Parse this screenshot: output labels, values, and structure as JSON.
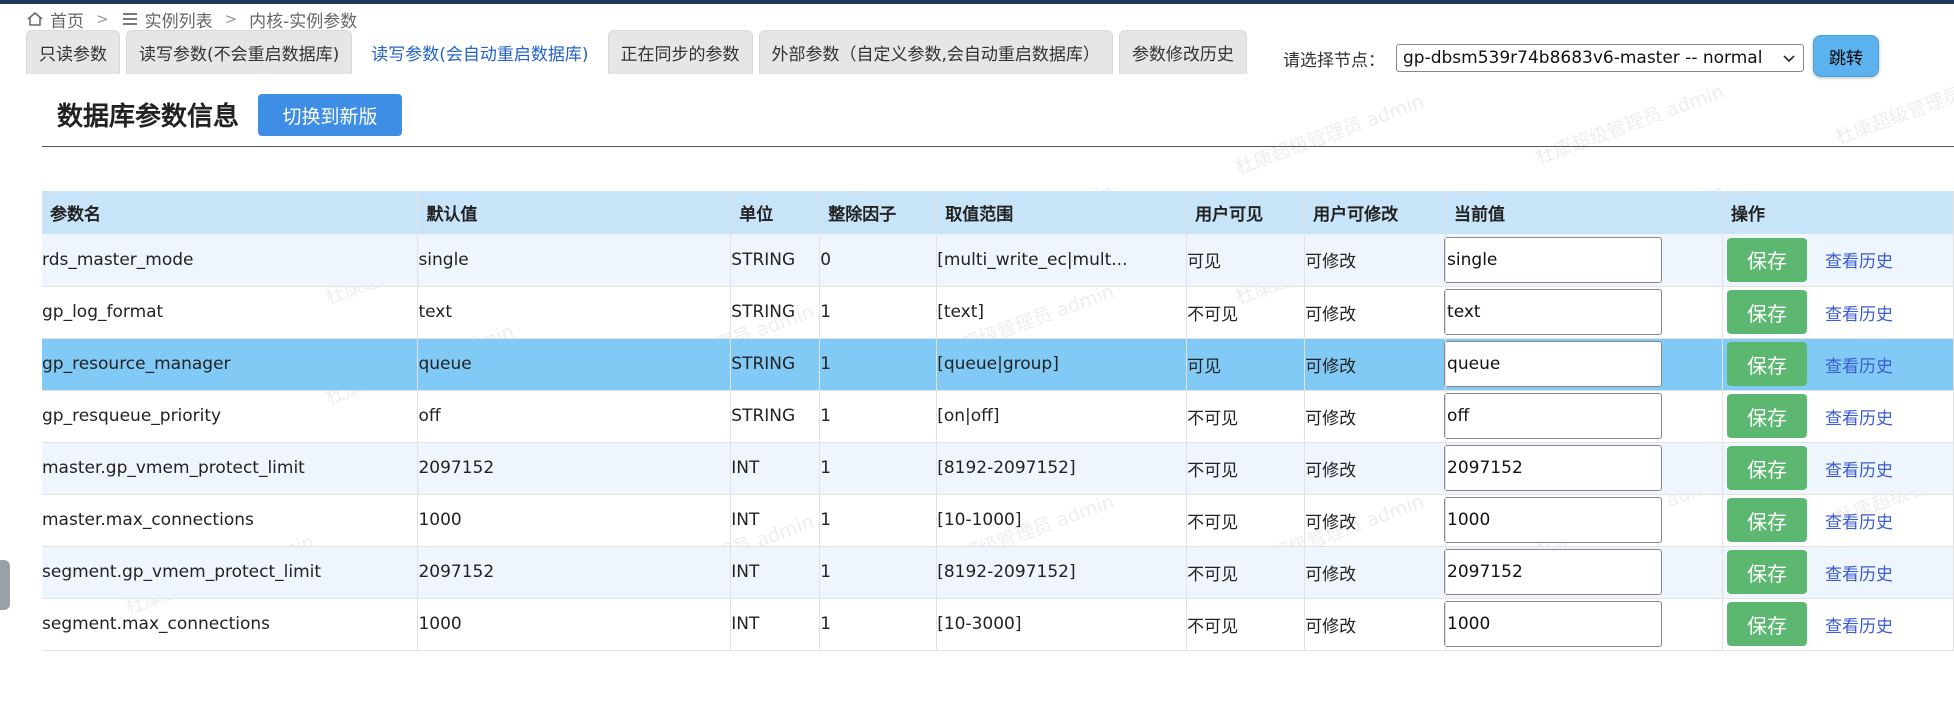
{
  "breadcrumb": {
    "home": "首页",
    "list": "实例列表",
    "current": "内核-实例参数"
  },
  "tabs": [
    {
      "label": "只读参数"
    },
    {
      "label": "读写参数(不会重启数据库)"
    },
    {
      "label": "读写参数(会自动重启数据库)"
    },
    {
      "label": "正在同步的参数"
    },
    {
      "label": "外部参数（自定义参数,会自动重启数据库）"
    },
    {
      "label": "参数修改历史"
    }
  ],
  "node": {
    "label": "请选择节点：",
    "selected": "gp-dbsm539r74b8683v6-master -- normal",
    "jump_label": "跳转"
  },
  "page": {
    "title": "数据库参数信息",
    "switch_label": "切换到新版"
  },
  "watermark": "杜康超级管理员 admin",
  "table": {
    "headers": [
      "参数名",
      "默认值",
      "单位",
      "整除因子",
      "取值范围",
      "用户可见",
      "用户可修改",
      "当前值",
      "操作"
    ],
    "save_label": "保存",
    "history_label": "查看历史",
    "rows": [
      {
        "name": "rds_master_mode",
        "default": "single",
        "unit": "STRING",
        "factor": "0",
        "range": "[multi_write_ec|mult...",
        "visible": "可见",
        "modifiable": "可修改",
        "current": "single"
      },
      {
        "name": "gp_log_format",
        "default": "text",
        "unit": "STRING",
        "factor": "1",
        "range": "[text]",
        "visible": "不可见",
        "modifiable": "可修改",
        "current": "text"
      },
      {
        "name": "gp_resource_manager",
        "default": "queue",
        "unit": "STRING",
        "factor": "1",
        "range": "[queue|group]",
        "visible": "可见",
        "modifiable": "可修改",
        "current": "queue"
      },
      {
        "name": "gp_resqueue_priority",
        "default": "off",
        "unit": "STRING",
        "factor": "1",
        "range": "[on|off]",
        "visible": "不可见",
        "modifiable": "可修改",
        "current": "off"
      },
      {
        "name": "master.gp_vmem_protect_limit",
        "default": "2097152",
        "unit": "INT",
        "factor": "1",
        "range": "[8192-2097152]",
        "visible": "不可见",
        "modifiable": "可修改",
        "current": "2097152"
      },
      {
        "name": "master.max_connections",
        "default": "1000",
        "unit": "INT",
        "factor": "1",
        "range": "[10-1000]",
        "visible": "不可见",
        "modifiable": "可修改",
        "current": "1000"
      },
      {
        "name": "segment.gp_vmem_protect_limit",
        "default": "2097152",
        "unit": "INT",
        "factor": "1",
        "range": "[8192-2097152]",
        "visible": "不可见",
        "modifiable": "可修改",
        "current": "2097152"
      },
      {
        "name": "segment.max_connections",
        "default": "1000",
        "unit": "INT",
        "factor": "1",
        "range": "[10-3000]",
        "visible": "不可见",
        "modifiable": "可修改",
        "current": "1000"
      }
    ]
  },
  "colors": {
    "header_bg": "#c8e4f8",
    "selected_row": "#81caf6",
    "save_button": "#5cb870",
    "switch_button": "#3f8ee6",
    "link": "#3a5cd0"
  }
}
